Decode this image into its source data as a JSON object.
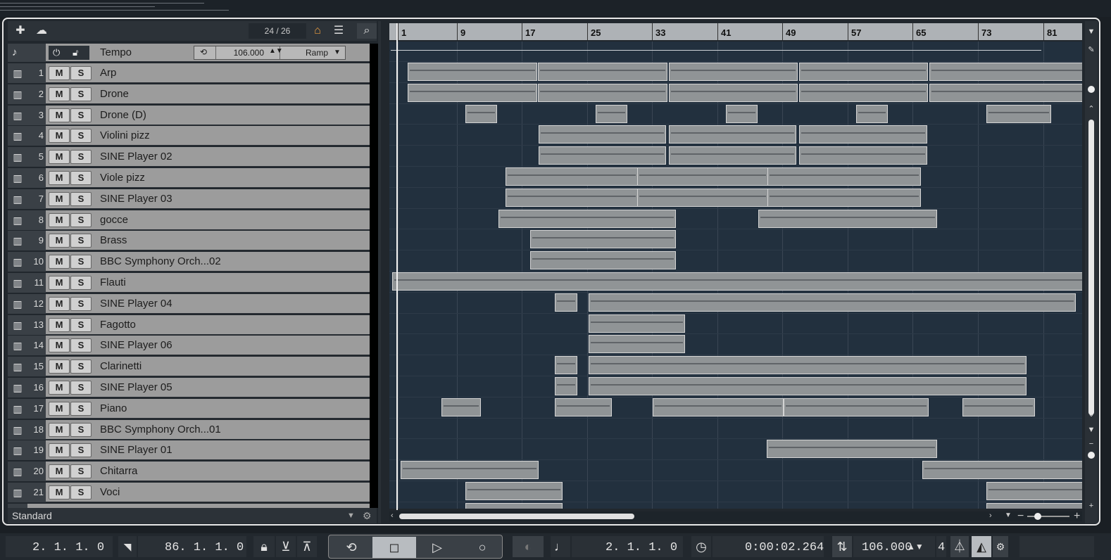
{
  "toolbar": {
    "add_icon": "plus-icon",
    "folder_icon": "cloud-folder-icon",
    "track_count": "24 / 26",
    "search_icon": "search-icon"
  },
  "tempo_track": {
    "name": "Tempo",
    "value": "106.000",
    "mode": "Ramp"
  },
  "tracks": [
    {
      "num": "1",
      "name": "Arp"
    },
    {
      "num": "2",
      "name": "Drone"
    },
    {
      "num": "3",
      "name": "Drone (D)"
    },
    {
      "num": "4",
      "name": "Violini pizz"
    },
    {
      "num": "5",
      "name": "SINE Player 02"
    },
    {
      "num": "6",
      "name": "Viole pizz"
    },
    {
      "num": "7",
      "name": "SINE Player 03"
    },
    {
      "num": "8",
      "name": "gocce"
    },
    {
      "num": "9",
      "name": "Brass"
    },
    {
      "num": "10",
      "name": "BBC Symphony Orch...02"
    },
    {
      "num": "11",
      "name": "Flauti"
    },
    {
      "num": "12",
      "name": "SINE Player 04"
    },
    {
      "num": "13",
      "name": "Fagotto"
    },
    {
      "num": "14",
      "name": "SINE Player 06"
    },
    {
      "num": "15",
      "name": "Clarinetti"
    },
    {
      "num": "16",
      "name": "SINE Player 05"
    },
    {
      "num": "17",
      "name": "Piano"
    },
    {
      "num": "18",
      "name": "BBC Symphony Orch...01"
    },
    {
      "num": "19",
      "name": "SINE Player 01"
    },
    {
      "num": "20",
      "name": "Chitarra"
    },
    {
      "num": "21",
      "name": "Voci"
    }
  ],
  "mute_label": "M",
  "solo_label": "S",
  "footer": {
    "preset": "Standard"
  },
  "ruler": {
    "bars": [
      "1",
      "9",
      "17",
      "25",
      "33",
      "41",
      "49",
      "57",
      "65",
      "73",
      "81"
    ]
  },
  "transport": {
    "left_locator": "2. 1. 1.    0",
    "right_locator": "86. 1. 1.    0",
    "position_bars": "2. 1. 1.    0",
    "position_time": "0:00:02.264",
    "tempo": "106.000",
    "signature": "4"
  }
}
